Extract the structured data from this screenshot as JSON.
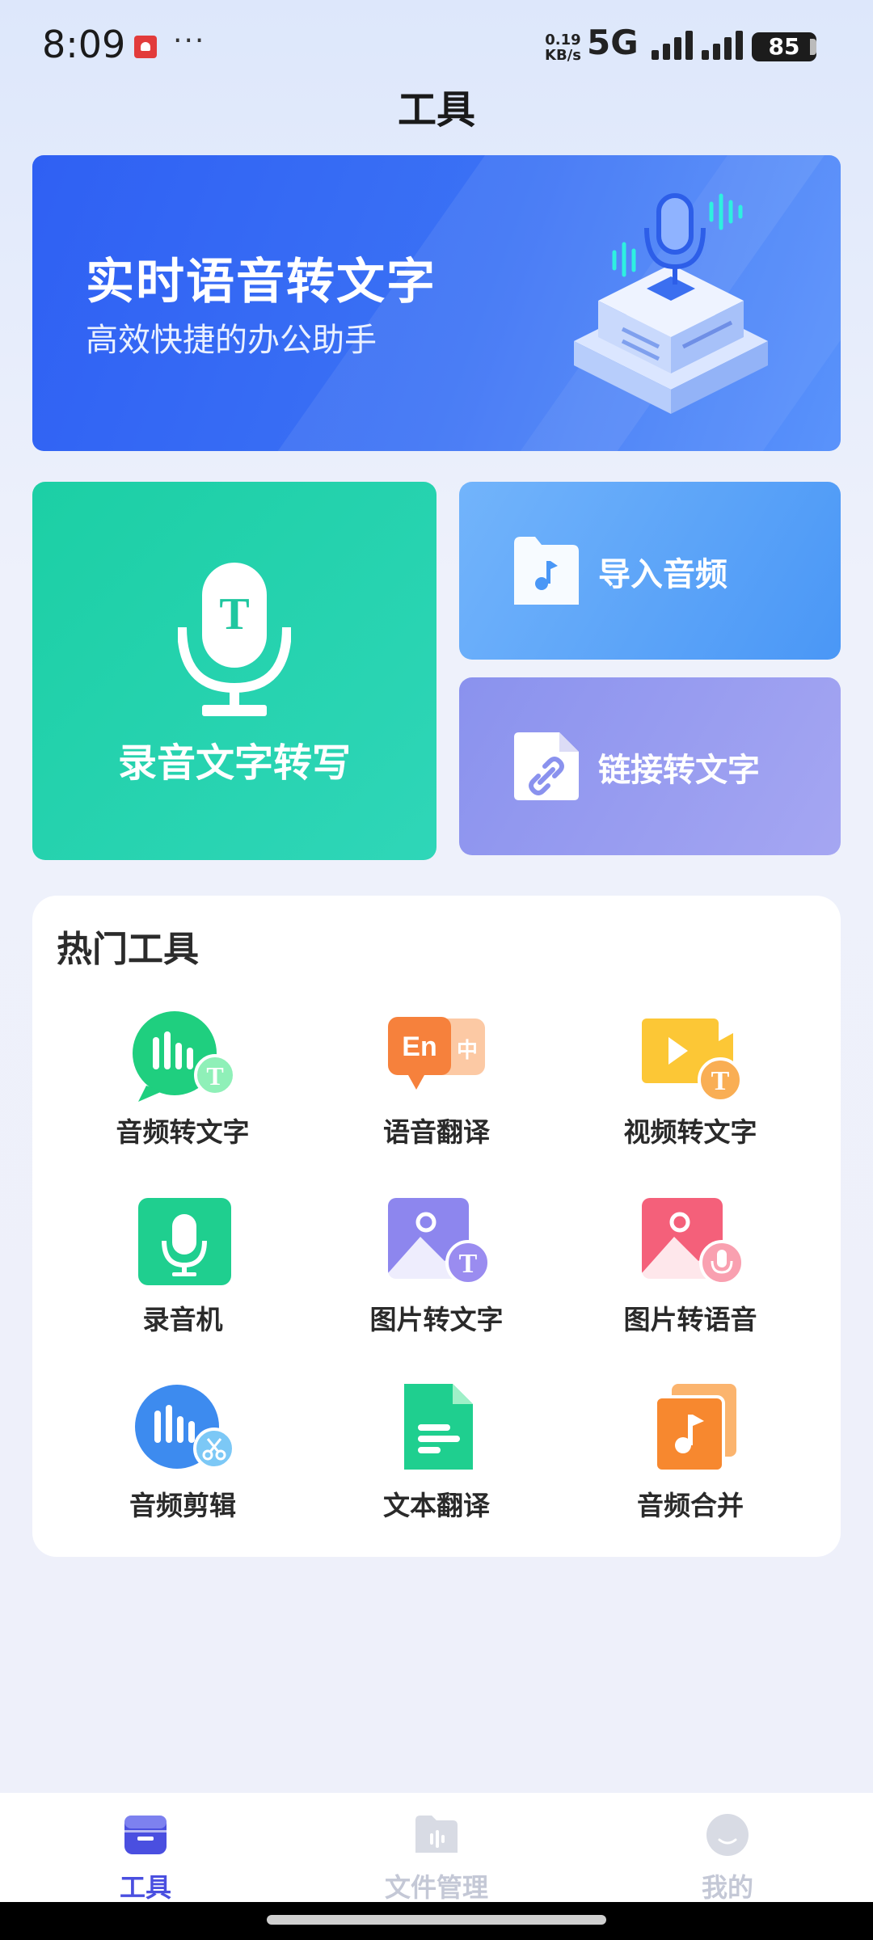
{
  "status_bar": {
    "time": "8:09",
    "dots": "···",
    "net_speed_top": "0.19",
    "net_speed_bottom": "KB/s",
    "network": "5G",
    "battery": "85"
  },
  "header": {
    "title": "工具"
  },
  "banner": {
    "title": "实时语音转文字",
    "subtitle": "高效快捷的办公助手"
  },
  "features": {
    "record": {
      "label": "录音文字转写",
      "icon": "mic-t-icon"
    },
    "import_audio": {
      "label": "导入音频",
      "icon": "folder-music-icon"
    },
    "link_to_text": {
      "label": "链接转文字",
      "icon": "link-file-icon"
    }
  },
  "hot_tools": {
    "title": "热门工具",
    "items": [
      {
        "label": "音频转文字",
        "icon": "audio-to-text-icon"
      },
      {
        "label": "语音翻译",
        "icon": "voice-translate-icon"
      },
      {
        "label": "视频转文字",
        "icon": "video-to-text-icon"
      },
      {
        "label": "录音机",
        "icon": "recorder-icon"
      },
      {
        "label": "图片转文字",
        "icon": "image-to-text-icon"
      },
      {
        "label": "图片转语音",
        "icon": "image-to-voice-icon"
      },
      {
        "label": "音频剪辑",
        "icon": "audio-cut-icon"
      },
      {
        "label": "文本翻译",
        "icon": "text-translate-icon"
      },
      {
        "label": "音频合并",
        "icon": "audio-merge-icon"
      }
    ]
  },
  "bottom_nav": {
    "items": [
      {
        "label": "工具",
        "active": true
      },
      {
        "label": "文件管理",
        "active": false
      },
      {
        "label": "我的",
        "active": false
      }
    ]
  },
  "colors": {
    "accent": "#4a4fe0",
    "inactive": "#c4c8d6",
    "record_card": "#1ccfa5",
    "import_card": "#4a97f6",
    "link_card": "#8a92ee"
  }
}
